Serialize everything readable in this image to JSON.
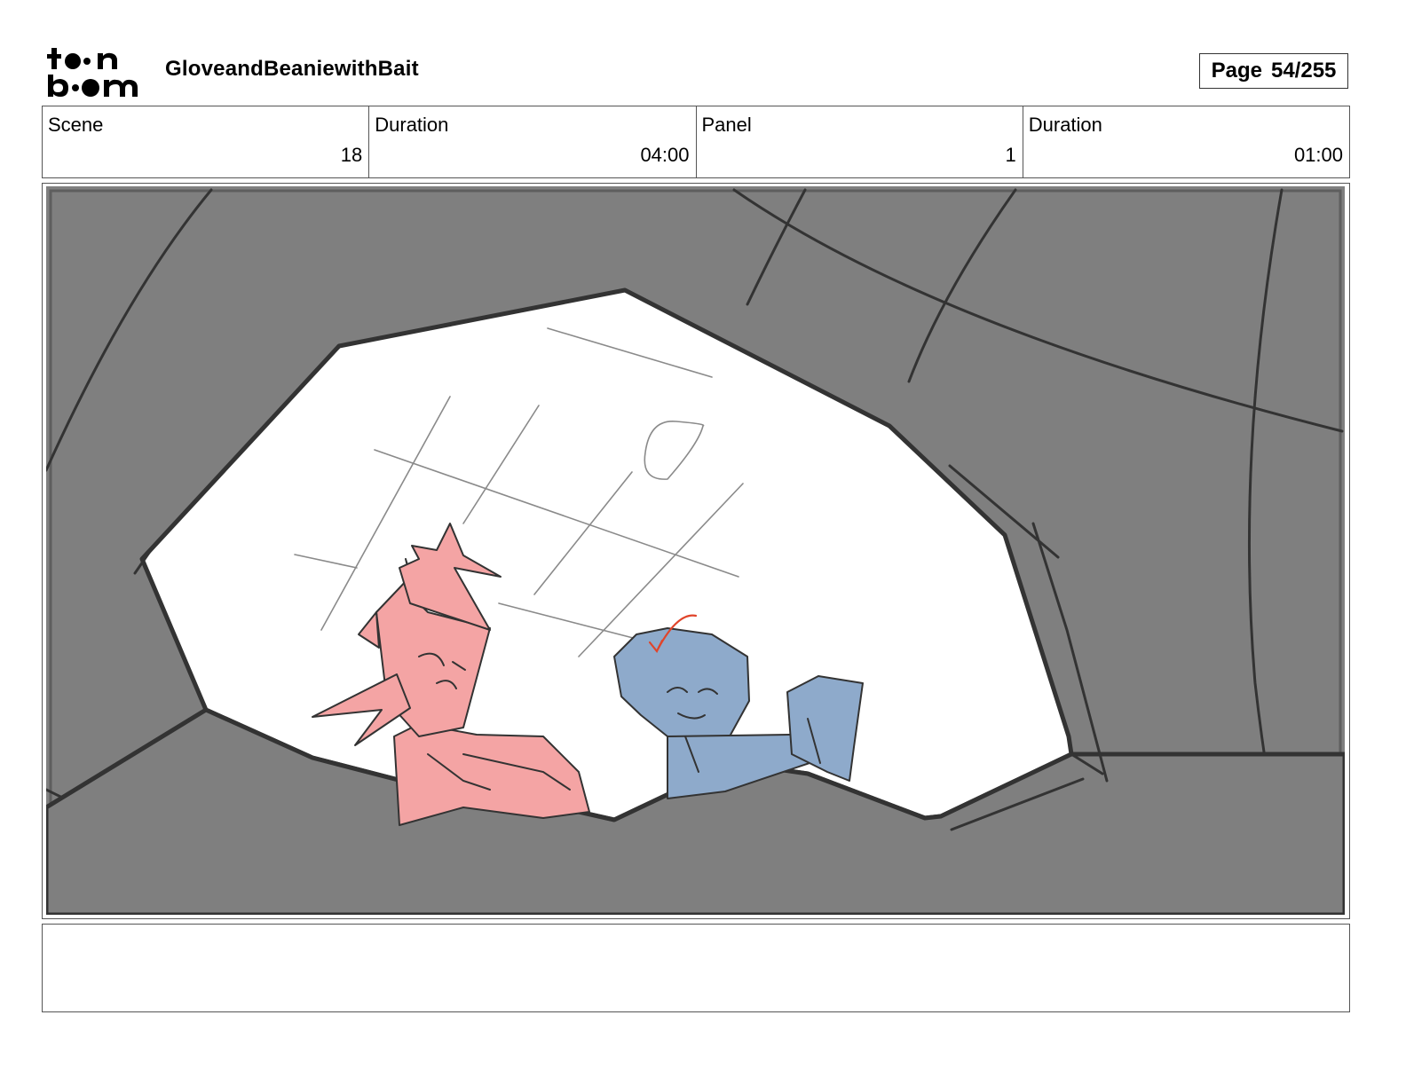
{
  "header": {
    "logo_icon": "toonboom-logo",
    "title": "GloveandBeaniewithBait",
    "page_label": "Page",
    "page_value": "54/255"
  },
  "info": {
    "scene_label": "Scene",
    "scene_value": "18",
    "scene_duration_label": "Duration",
    "scene_duration_value": "04:00",
    "panel_label": "Panel",
    "panel_value": "1",
    "panel_duration_label": "Duration",
    "panel_duration_value": "01:00"
  },
  "panel": {
    "image_icon": "storyboard-sketch",
    "colors": {
      "frame_gray": "#7f7f7f",
      "sky": "#ffffff",
      "character_pink": "#f4a4a4",
      "character_blue": "#8eaacb",
      "motion_arrow": "#e0442a"
    }
  },
  "notes": {
    "text": ""
  }
}
